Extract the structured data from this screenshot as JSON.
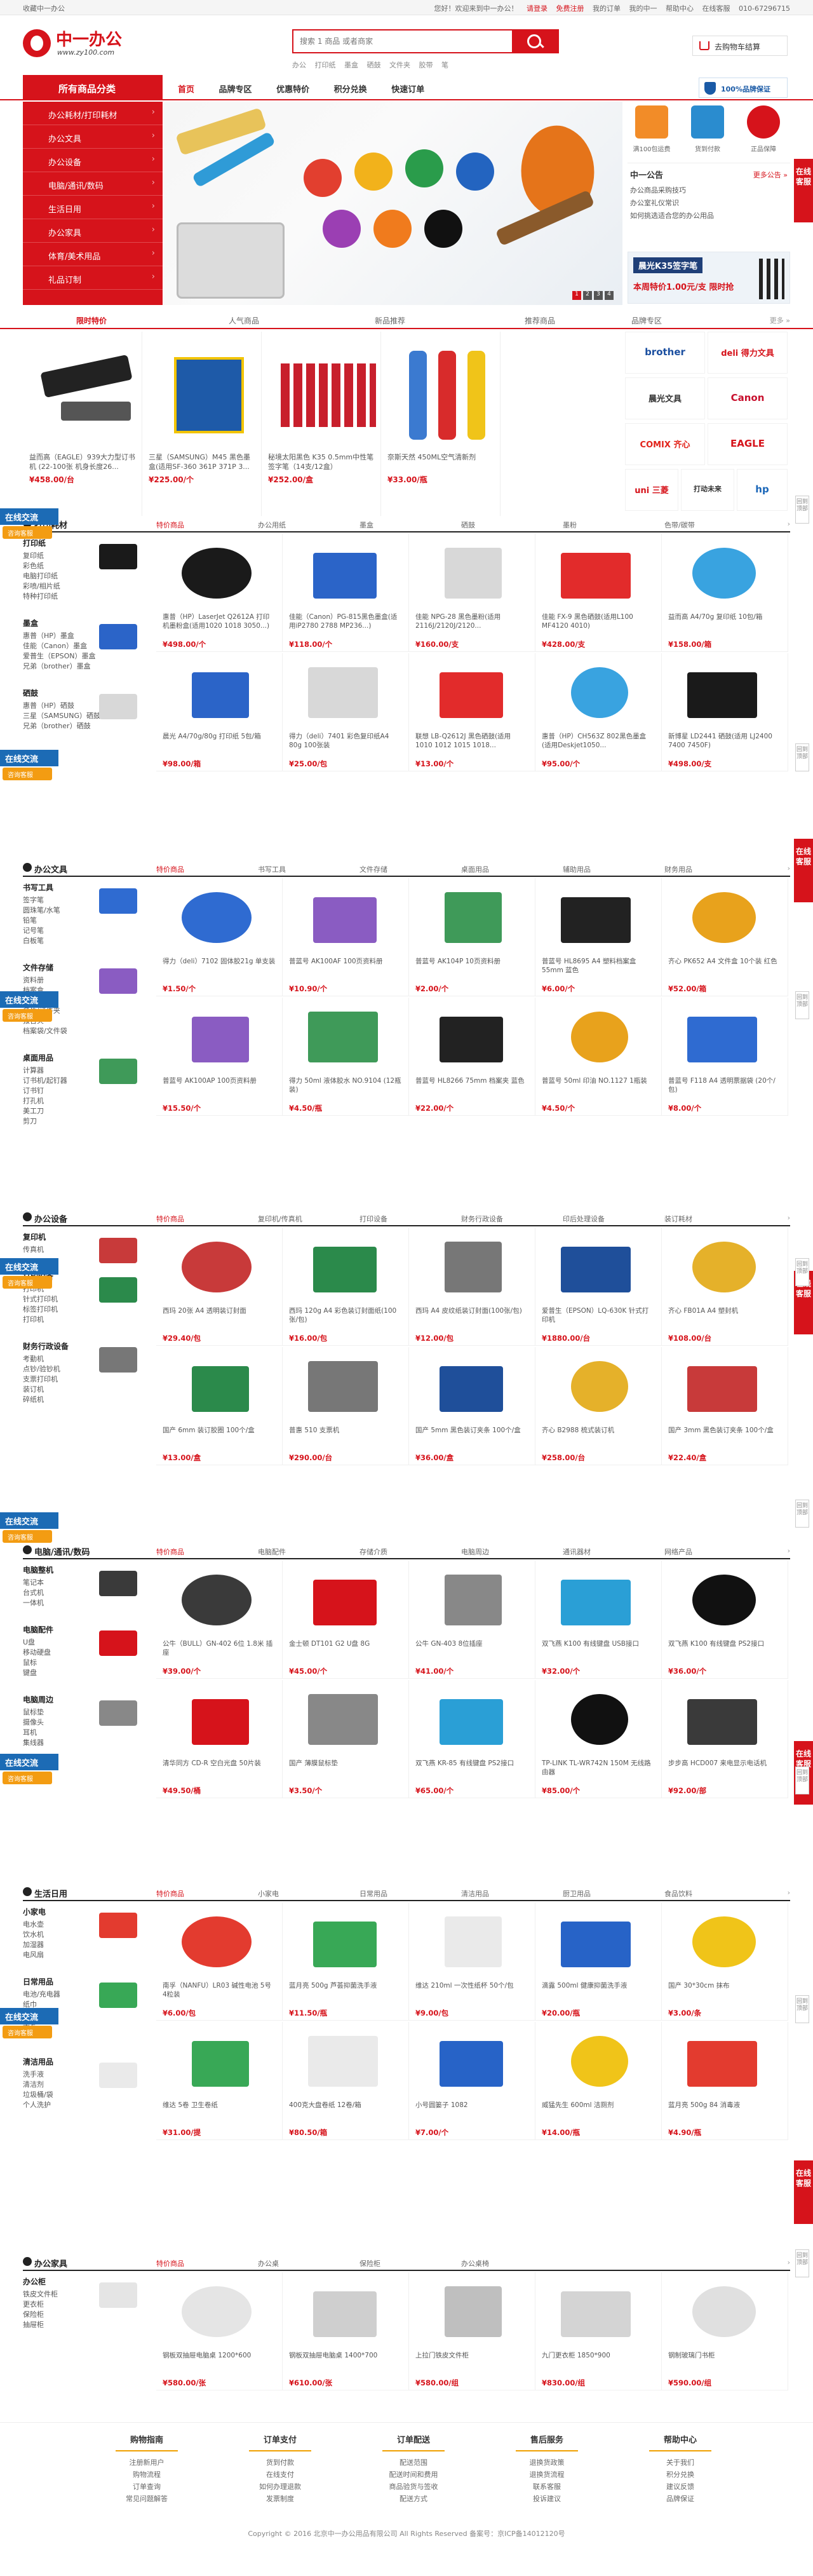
{
  "topbar": {
    "left": "收藏中一办公",
    "links": [
      "您好！欢迎来到中一办公！",
      "请登录",
      "免费注册",
      "我的订单",
      "我的中一",
      "帮助中心",
      "在线客服"
    ],
    "phone": "010-67296715"
  },
  "header": {
    "logo_cn": "中一办公",
    "logo_en": "www.zy100.com",
    "search_placeholder": "搜索 1 商品 或者商家",
    "hotwords": [
      "办公",
      "打印纸",
      "墨盒",
      "硒鼓",
      "文件夹",
      "胶带",
      "笔"
    ],
    "cart": "去购物车结算"
  },
  "nav": {
    "category_label": "所有商品分类",
    "items": [
      "首页",
      "品牌专区",
      "优惠特价",
      "积分兑换",
      "快速订单"
    ],
    "badge": "100%品牌保证"
  },
  "catmenu": [
    "办公耗材/打印耗材",
    "办公文具",
    "办公设备",
    "电脑/通讯/数码",
    "生活日用",
    "办公家具",
    "体育/美术用品",
    "礼品订制"
  ],
  "banner": {
    "dots": [
      "1",
      "2",
      "3",
      "4"
    ]
  },
  "rpanel": {
    "icons": [
      "满100包运费",
      "货到付款",
      "正品保障"
    ],
    "news_title": "中一公告",
    "news_more": "更多公告 »",
    "news": [
      "办公商品采购技巧",
      "办公室礼仪常识",
      "如何挑选适合您的办公用品"
    ],
    "promo_title": "晨光K35签字笔",
    "promo_sub": "本周特价1.00元/支 限时抢"
  },
  "tabs1": {
    "tabs": [
      "限时特价",
      "人气商品",
      "新品推荐",
      "推荐商品"
    ],
    "right": "品牌专区",
    "more": "更多 »"
  },
  "featured": [
    {
      "name": "益而高（EAGLE）939大力型订书机 (22-100张 机身长度26...",
      "price": "¥458.00/台"
    },
    {
      "name": "三星（SAMSUNG）M45 黑色墨盒(适用SF-360 361P 371P 3...",
      "price": "¥225.00/个"
    },
    {
      "name": "秘境太阳黑色 K35 0.5mm中性笔 签字笔（14支/12盒）",
      "price": "¥252.00/盒"
    },
    {
      "name": "奈斯天然 450ML空气清新剂",
      "price": "¥33.00/瓶"
    },
    {
      "name": "",
      "price": ""
    }
  ],
  "brands": [
    "brother",
    "deli 得力文具",
    "晨光文具",
    "Canon",
    "COMIX 齐心",
    "EAGLE",
    "uni 三菱",
    "打动未来",
    "hp"
  ],
  "floors": [
    {
      "title": "打印耗材",
      "tabs": [
        "特价商品",
        "办公用纸",
        "墨盒",
        "硒鼓",
        "墨粉",
        "色带/碳带"
      ],
      "side": [
        {
          "h": "打印纸",
          "items": [
            "复印纸",
            "彩色纸",
            "电脑打印纸",
            "彩喷/相片纸",
            "特种打印纸"
          ]
        },
        {
          "h": "墨盒",
          "items": [
            "惠普（HP）墨盒",
            "佳能（Canon）墨盒",
            "爱普生（EPSON）墨盒",
            "兄弟（brother）墨盒"
          ]
        },
        {
          "h": "硒鼓",
          "items": [
            "惠普（HP）硒鼓",
            "三星（SAMSUNG）硒鼓",
            "兄弟（brother）硒鼓"
          ]
        }
      ],
      "products": [
        {
          "name": "惠普（HP）LaserJet Q2612A 打印机墨粉盒(适用1020 1018 3050...)",
          "price": "¥498.00/个"
        },
        {
          "name": "佳能（Canon）PG-815黑色墨盒(适用iP2780 2788 MP236...)",
          "price": "¥118.00/个"
        },
        {
          "name": "佳能 NPG-28 黑色墨粉(适用2116J/2120J/2120...",
          "price": "¥160.00/支"
        },
        {
          "name": "佳能 FX-9 黑色硒鼓(适用L100 MF4120 4010)",
          "price": "¥428.00/支"
        },
        {
          "name": "益而高 A4/70g 复印纸 10包/箱",
          "price": "¥158.00/箱"
        },
        {
          "name": "晨光 A4/70g/80g 打印纸 5包/箱",
          "price": "¥98.00/箱"
        },
        {
          "name": "得力（deli）7401 彩色复印纸A4 80g 100张装",
          "price": "¥25.00/包"
        },
        {
          "name": "联想 LB-Q2612J 黑色硒鼓(适用 1010 1012 1015 1018...",
          "price": "¥13.00/个"
        },
        {
          "name": "惠普（HP）CH563Z 802黑色墨盒(适用Deskjet1050...",
          "price": "¥95.00/个"
        },
        {
          "name": "新博星 LD2441 硒鼓(适用 LJ2400 7400 7450F)",
          "price": "¥498.00/支"
        }
      ]
    },
    {
      "title": "办公文具",
      "tabs": [
        "特价商品",
        "书写工具",
        "文件存储",
        "桌面用品",
        "辅助用品",
        "财务用品"
      ],
      "side": [
        {
          "h": "书写工具",
          "items": [
            "签字笔",
            "圆珠笔/水笔",
            "铅笔",
            "记号笔",
            "白板笔"
          ]
        },
        {
          "h": "文件存储",
          "items": [
            "资料册",
            "档案盒",
            "文件夹",
            "名片/证件夹",
            "报告夹",
            "档案袋/文件袋"
          ]
        },
        {
          "h": "桌面用品",
          "items": [
            "计算器",
            "订书机/起钉器",
            "订书钉",
            "打孔机",
            "美工刀",
            "剪刀"
          ]
        }
      ],
      "products": [
        {
          "name": "得力（deli）7102 固体胶21g 单支装",
          "price": "¥1.50/个"
        },
        {
          "name": "普蓝号 AK100AF 100页资料册",
          "price": "¥10.90/个"
        },
        {
          "name": "普蓝号 AK104P 10页资料册",
          "price": "¥2.00/个"
        },
        {
          "name": "普蓝号 HL8695 A4 塑料档案盒 55mm 蓝色",
          "price": "¥6.00/个"
        },
        {
          "name": "齐心 PK652 A4 文件盒 10个装 红色",
          "price": "¥52.00/箱"
        },
        {
          "name": "普蓝号 AK100AP 100页资料册",
          "price": "¥15.50/个"
        },
        {
          "name": "得力 50ml 液体胶水 NO.9104 (12瓶装)",
          "price": "¥4.50/瓶"
        },
        {
          "name": "普蓝号 HL8266 75mm 档案夹 蓝色",
          "price": "¥22.00/个"
        },
        {
          "name": "普蓝号 50ml 印油 NO.1127 1瓶装",
          "price": "¥4.50/个"
        },
        {
          "name": "普蓝号 F118 A4 透明票据袋 (20个/包)",
          "price": "¥8.00/个"
        }
      ]
    },
    {
      "title": "办公设备",
      "tabs": [
        "特价商品",
        "复印机/传真机",
        "打印设备",
        "财务行政设备",
        "印后处理设备",
        "装订耗材"
      ],
      "side": [
        {
          "h": "复印机",
          "items": [
            "传真机"
          ]
        },
        {
          "h": "打印设备",
          "items": [
            "打印机",
            "针式打印机",
            "标签打印机",
            "打印机"
          ]
        },
        {
          "h": "财务行政设备",
          "items": [
            "考勤机",
            "点钞/验钞机",
            "支票打印机",
            "装订机",
            "碎纸机"
          ]
        }
      ],
      "products": [
        {
          "name": "西玛 20张 A4 透明装订封面",
          "price": "¥29.40/包"
        },
        {
          "name": "西玛 120g A4 彩色装订封面纸(100张/包)",
          "price": "¥16.00/包"
        },
        {
          "name": "西玛 A4 皮纹纸装订封面(100张/包)",
          "price": "¥12.00/包"
        },
        {
          "name": "爱普生（EPSON）LQ-630K 针式打印机",
          "price": "¥1880.00/台"
        },
        {
          "name": "齐心 FB01A A4 塑封机",
          "price": "¥108.00/台"
        },
        {
          "name": "国产 6mm 装订胶圈 100个/盒",
          "price": "¥13.00/盒"
        },
        {
          "name": "普惠 510 支票机",
          "price": "¥290.00/台"
        },
        {
          "name": "国产 5mm 黑色装订夹条 100个/盒",
          "price": "¥36.00/盒"
        },
        {
          "name": "齐心 B2988 梳式装订机",
          "price": "¥258.00/台"
        },
        {
          "name": "国产 3mm 黑色装订夹条 100个/盒",
          "price": "¥22.40/盒"
        }
      ]
    },
    {
      "title": "电脑/通讯/数码",
      "tabs": [
        "特价商品",
        "电脑配件",
        "存储介质",
        "电脑周边",
        "通讯器材",
        "网络产品"
      ],
      "side": [
        {
          "h": "电脑整机",
          "items": [
            "笔记本",
            "台式机",
            "一体机"
          ]
        },
        {
          "h": "电脑配件",
          "items": [
            "U盘",
            "移动硬盘",
            "鼠标",
            "键盘"
          ]
        },
        {
          "h": "电脑周边",
          "items": [
            "鼠标垫",
            "摄像头",
            "耳机",
            "集线器"
          ]
        }
      ],
      "products": [
        {
          "name": "公牛（BULL）GN-402 6位 1.8米 插座",
          "price": "¥39.00/个"
        },
        {
          "name": "金士顿 DT101 G2 U盘 8G",
          "price": "¥45.00/个"
        },
        {
          "name": "公牛 GN-403 8位插座",
          "price": "¥41.00/个"
        },
        {
          "name": "双飞燕 K100 有线键盘 USB接口",
          "price": "¥32.00/个"
        },
        {
          "name": "双飞燕 K100 有线键盘 PS2接口",
          "price": "¥36.00/个"
        },
        {
          "name": "清华同方 CD-R 空白光盘 50片装",
          "price": "¥49.50/桶"
        },
        {
          "name": "国产 薄膜鼠标垫",
          "price": "¥3.50/个"
        },
        {
          "name": "双飞燕 KR-85 有线键盘 PS2接口",
          "price": "¥65.00/个"
        },
        {
          "name": "TP-LINK TL-WR742N 150M 无线路由器",
          "price": "¥85.00/个"
        },
        {
          "name": "步步高 HCD007 来电显示电话机",
          "price": "¥92.00/部"
        }
      ]
    },
    {
      "title": "生活日用",
      "tabs": [
        "特价商品",
        "小家电",
        "日常用品",
        "清洁用品",
        "厨卫用品",
        "食品饮料"
      ],
      "side": [
        {
          "h": "小家电",
          "items": [
            "电水壶",
            "饮水机",
            "加湿器",
            "电风扇"
          ]
        },
        {
          "h": "日常用品",
          "items": [
            "电池/充电器",
            "纸巾",
            "雨伞",
            "手套",
            "毛巾"
          ]
        },
        {
          "h": "清洁用品",
          "items": [
            "洗手液",
            "清洁剂",
            "垃圾桶/袋",
            "个人洗护"
          ]
        }
      ],
      "products": [
        {
          "name": "南孚（NANFU）LR03 碱性电池 5号 4粒装",
          "price": "¥6.00/包"
        },
        {
          "name": "蓝月亮 500g 芦荟抑菌洗手液",
          "price": "¥11.50/瓶"
        },
        {
          "name": "维达 210ml 一次性纸杯 50个/包",
          "price": "¥9.00/包"
        },
        {
          "name": "滴露 500ml 健康抑菌洗手液",
          "price": "¥20.00/瓶"
        },
        {
          "name": "国产 30*30cm 抹布",
          "price": "¥3.00/条"
        },
        {
          "name": "维达 5卷 卫生卷纸",
          "price": "¥31.00/提"
        },
        {
          "name": "400克大盘卷纸 12卷/箱",
          "price": "¥80.50/箱"
        },
        {
          "name": "小号圆篓子 1082",
          "price": "¥7.00/个"
        },
        {
          "name": "威猛先生 600ml 洁厕剂",
          "price": "¥14.00/瓶"
        },
        {
          "name": "蓝月亮 500g 84 消毒液",
          "price": "¥4.90/瓶"
        }
      ]
    },
    {
      "title": "办公家具",
      "tabs": [
        "特价商品",
        "办公桌",
        "保险柜",
        "办公桌椅"
      ],
      "side": [
        {
          "h": "办公柜",
          "items": [
            "铁皮文件柜",
            "更衣柜",
            "保险柜",
            "抽屉柜"
          ]
        }
      ],
      "products": [
        {
          "name": "钢板双抽屉电脑桌 1200*600",
          "price": "¥580.00/张"
        },
        {
          "name": "钢板双抽屉电脑桌 1400*700",
          "price": "¥610.00/张"
        },
        {
          "name": "上拉门铁皮文件柜",
          "price": "¥580.00/组"
        },
        {
          "name": "九门更衣柜 1850*900",
          "price": "¥830.00/组"
        },
        {
          "name": "钢制玻璃门书柜",
          "price": "¥590.00/组"
        }
      ]
    }
  ],
  "service": {
    "left_title": "在线交流",
    "left_sub": "咨询客服",
    "right": "在线客服",
    "backtop": "回到顶部"
  },
  "footer": {
    "cols": [
      {
        "h": "购物指南",
        "items": [
          "注册新用户",
          "购物流程",
          "订单查询",
          "常见问题解答"
        ]
      },
      {
        "h": "订单支付",
        "items": [
          "货到付款",
          "在线支付",
          "如何办理退款",
          "发票制度"
        ]
      },
      {
        "h": "订单配送",
        "items": [
          "配送范围",
          "配送时间和费用",
          "商品验货与签收",
          "配送方式"
        ]
      },
      {
        "h": "售后服务",
        "items": [
          "退换货政策",
          "退换货流程",
          "联系客服",
          "投诉建议"
        ]
      },
      {
        "h": "帮助中心",
        "items": [
          "关于我们",
          "积分兑换",
          "建议反馈",
          "品牌保证"
        ]
      }
    ],
    "copy": "Copyright © 2016 北京中一办公用品有限公司 All Rights Reserved 备案号：京ICP备14012120号"
  }
}
